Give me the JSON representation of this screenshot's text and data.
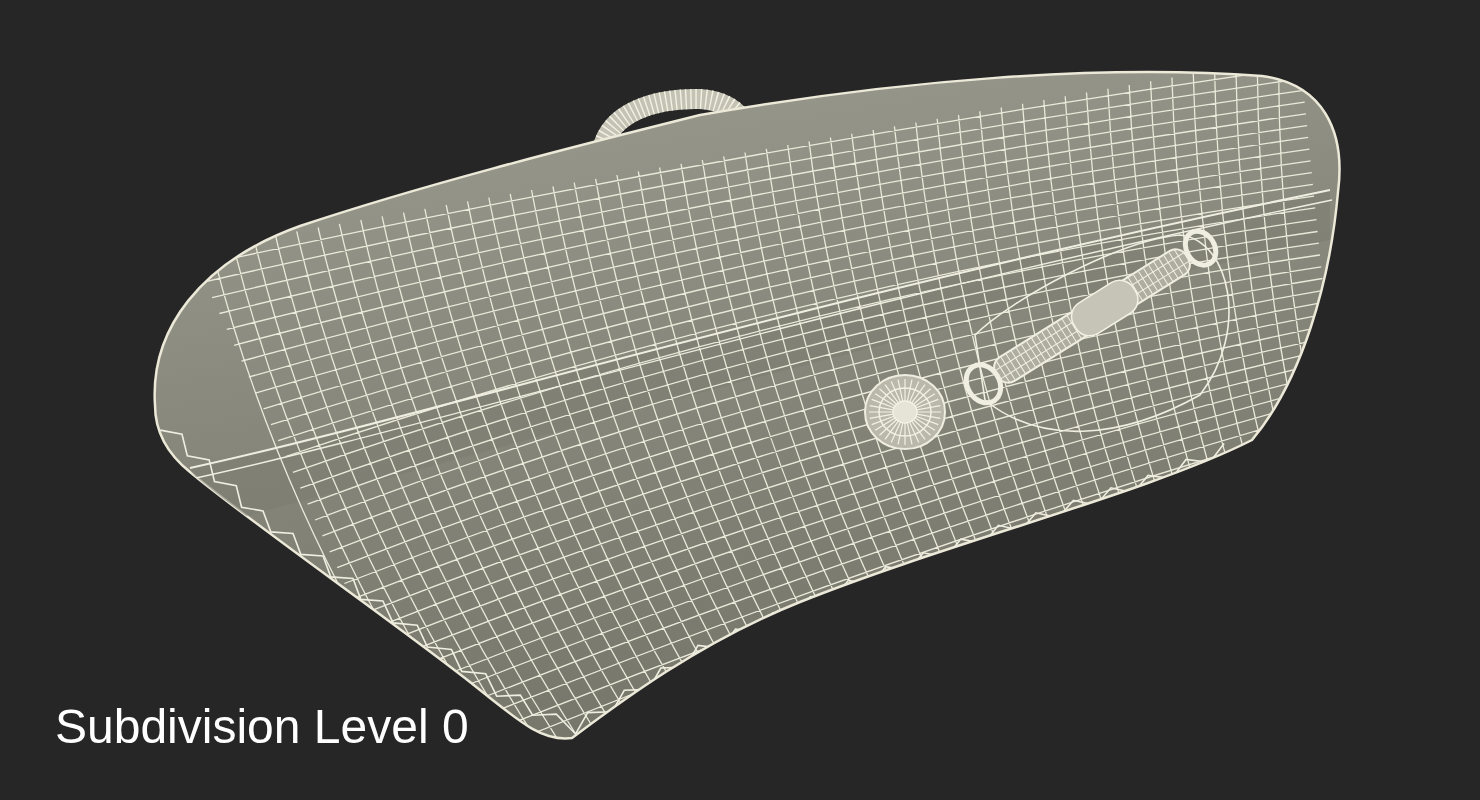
{
  "caption": {
    "text": "Subdivision Level 0"
  }
}
